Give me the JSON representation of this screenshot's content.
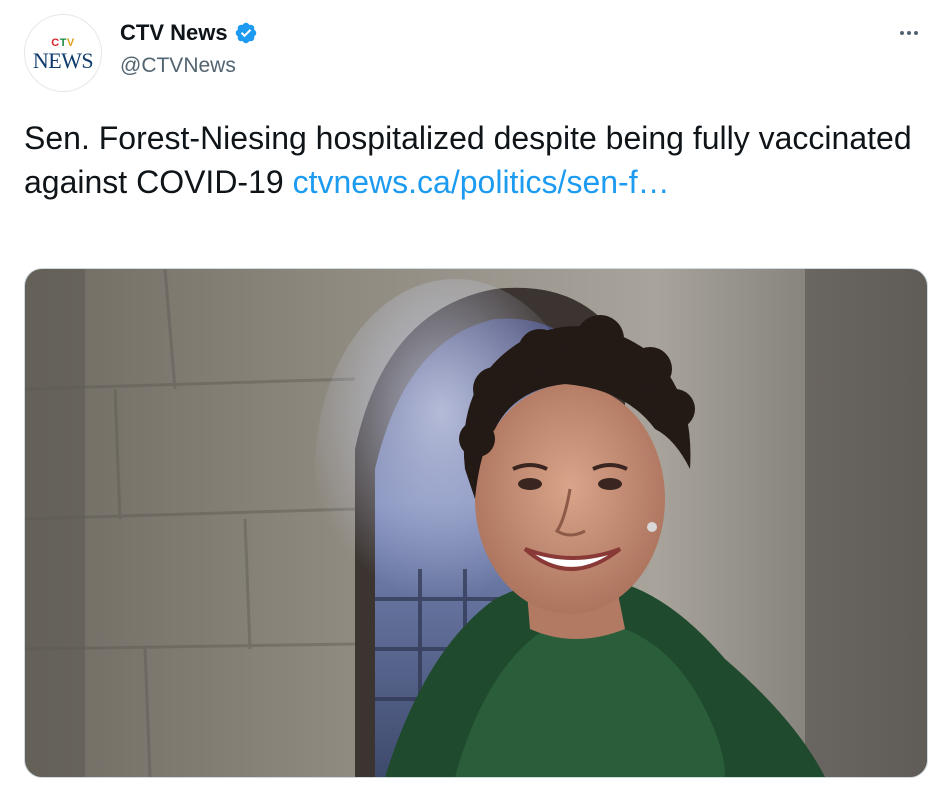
{
  "account": {
    "display_name": "CTV News",
    "handle": "@CTVNews",
    "verified_icon": "verified-badge-icon",
    "avatar_logo_top": "CTV",
    "avatar_logo_bottom": "NEWS"
  },
  "tweet": {
    "text": "Sen. Forest-Niesing hospitalized despite being fully vaccinated against COVID-19 ",
    "link_text": "ctvnews.ca/politics/sen-f…"
  },
  "menu": {
    "more_icon": "more-options-icon"
  },
  "media": {
    "type": "photo"
  },
  "colors": {
    "link": "#1d9bf0",
    "verified": "#1d9bf0",
    "secondary_text": "#536471",
    "primary_text": "#0f1419"
  }
}
